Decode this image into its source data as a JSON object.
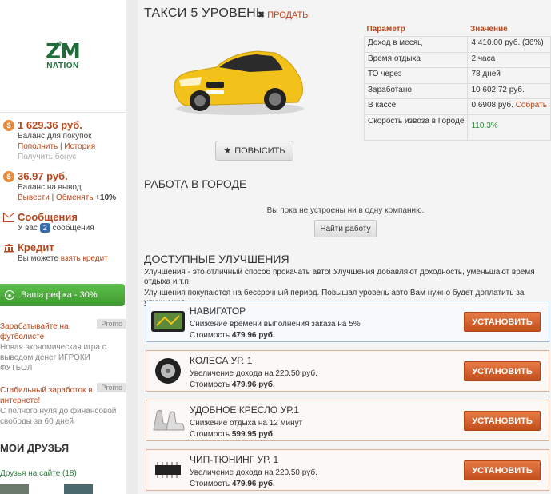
{
  "logo": {
    "text": "ZM",
    "sub": "NATION"
  },
  "sidebar": {
    "balance_buy": {
      "amount": "1 629.36 руб.",
      "desc": "Баланс для покупок",
      "link1": "Пополнить",
      "link2": "История",
      "disabled": "Получить бонус"
    },
    "balance_out": {
      "amount": "36.97 руб.",
      "desc": "Баланс на вывод",
      "link1": "Вывести",
      "link2": "Обменять",
      "bonus": "+10%"
    },
    "messages": {
      "title": "Сообщения",
      "pre": "У вас",
      "count": "2",
      "post": "сообщения"
    },
    "credit": {
      "title": "Кредит",
      "pre": "Вы можете",
      "link": "взять кредит"
    },
    "referral": "Ваша рефка - 30%",
    "promo1": {
      "tag": "Promo",
      "title": "Зарабатывайте на футболисте",
      "text": "Новая экономическая игра с выводом денег ИГРОКИ ФУТБОЛ"
    },
    "promo2": {
      "tag": "Promo",
      "title": "Стабильный заработок в интернете!",
      "text": "С полного нуля до финансовой свободы за 60 дней"
    },
    "friends_title": "МОИ ДРУЗЬЯ",
    "friends_link": "Друзья на сайте (18)"
  },
  "main": {
    "title": "ТАКСИ 5 УРОВЕНЬ",
    "sell": "ПРОДАТЬ",
    "boost": "ПОВЫСИТЬ",
    "params": {
      "head_param": "Параметр",
      "head_value": "Значение",
      "rows": [
        {
          "k": "Доход в месяц",
          "v": "4 410.00 руб. (36%)"
        },
        {
          "k": "Время отдыха",
          "v": "2 часа"
        },
        {
          "k": "ТО через",
          "v": "78 дней"
        },
        {
          "k": "Заработано",
          "v": "10 602.72 руб."
        },
        {
          "k": "В кассе",
          "v": "0.6908 руб.",
          "link": "Собрать"
        },
        {
          "k": "Скорость извоза в Городе",
          "v": "110.3%"
        }
      ]
    },
    "city_title": "РАБОТА В ГОРОДЕ",
    "city_msg": "Вы пока не устроены ни в одну компанию.",
    "job_btn": "Найти работу",
    "upg_title": "ДОСТУПНЫЕ УЛУЧШЕНИЯ",
    "upg_desc1": "Улучшения - это отличный способ прокачать авто! Улучшения добавляют доходность, уменьшают время отдыха и т.п.",
    "upg_desc2": "Улучшения покупаются на бессрочный период. Повышая уровень авто Вам нужно будет доплатить за улучшения.",
    "install_label": "УСТАНОВИТЬ",
    "cost_label": "Стоимость",
    "upgrades": [
      {
        "icon": "navigator-icon",
        "name": "НАВИГАТОР",
        "effect": "Снижение времени выполнения заказа на 5%",
        "price": "479.96 руб."
      },
      {
        "icon": "wheel-icon",
        "name": "КОЛЕСА УР. 1",
        "effect": "Увеличение дохода на 220.50 руб.",
        "price": "479.96 руб."
      },
      {
        "icon": "seat-icon",
        "name": "УДОБНОЕ КРЕСЛО УР.1",
        "effect": "Снижение отдыха на 12 минут",
        "price": "599.95 руб."
      },
      {
        "icon": "chip-icon",
        "name": "ЧИП-ТЮНИНГ УР. 1",
        "effect": "Увеличение дохода на 220.50 руб.",
        "price": "479.96 руб."
      }
    ]
  }
}
